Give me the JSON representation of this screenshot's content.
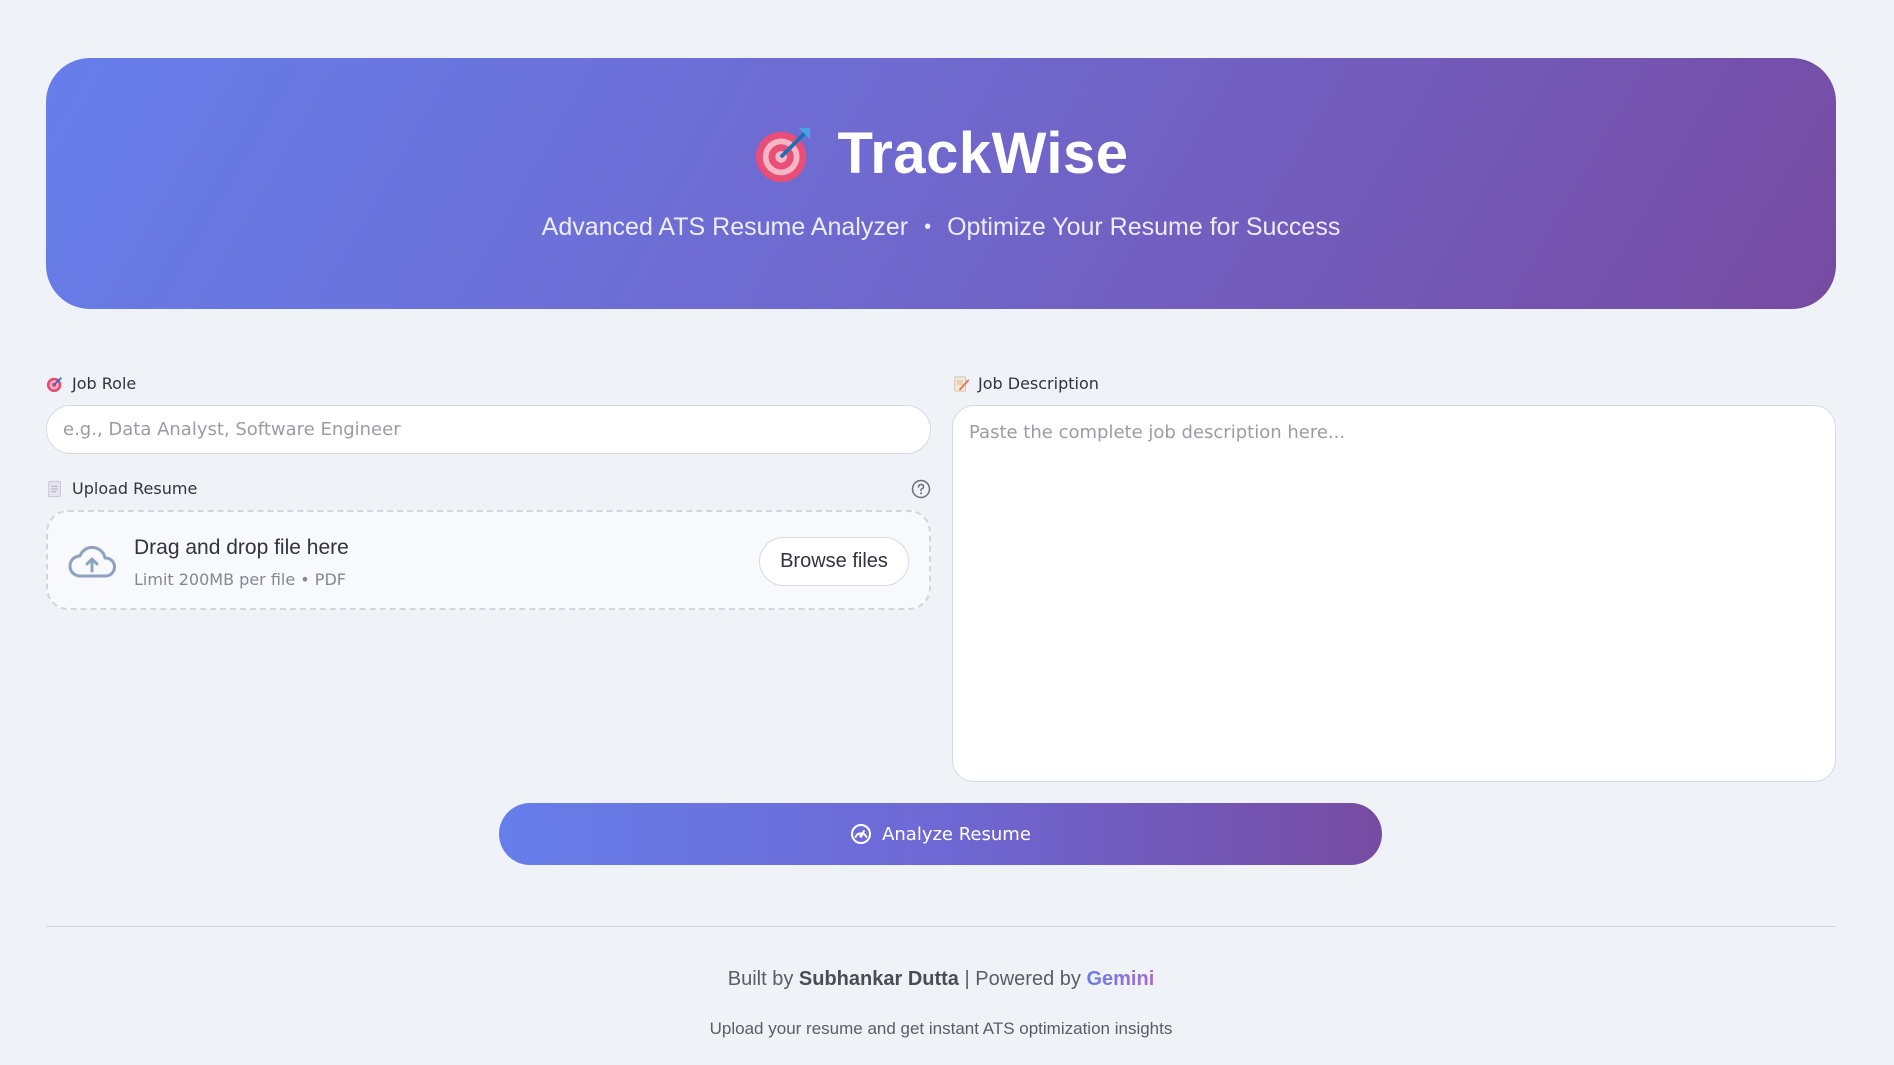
{
  "header": {
    "icon": "dart-target-icon",
    "title": "TrackWise",
    "subtitle_left": "Advanced ATS Resume Analyzer",
    "subtitle_sep": "•",
    "subtitle_right": "Optimize Your Resume for Success",
    "gradient": [
      "#667eea",
      "#764ba2"
    ]
  },
  "job_role": {
    "icon": "dart-target-icon",
    "label": "Job Role",
    "placeholder": "e.g., Data Analyst, Software Engineer",
    "value": ""
  },
  "upload": {
    "icon": "document-icon",
    "label": "Upload Resume",
    "help_icon": "question-circle-icon",
    "dropzone_icon": "cloud-upload-icon",
    "dropzone_title": "Drag and drop file here",
    "dropzone_limit": "Limit 200MB per file • PDF",
    "browse_label": "Browse files"
  },
  "job_description": {
    "icon": "memo-icon",
    "label": "Job Description",
    "placeholder": "Paste the complete job description here...",
    "value": ""
  },
  "analyze": {
    "icon": "gauge-icon",
    "label": "Analyze Resume"
  },
  "footer": {
    "built_by_prefix": "Built by",
    "author": "Subhankar Dutta",
    "separator": "|",
    "powered_by_prefix": "Powered by",
    "powered_by": "Gemini",
    "tagline": "Upload your resume and get instant ATS optimization insights"
  }
}
